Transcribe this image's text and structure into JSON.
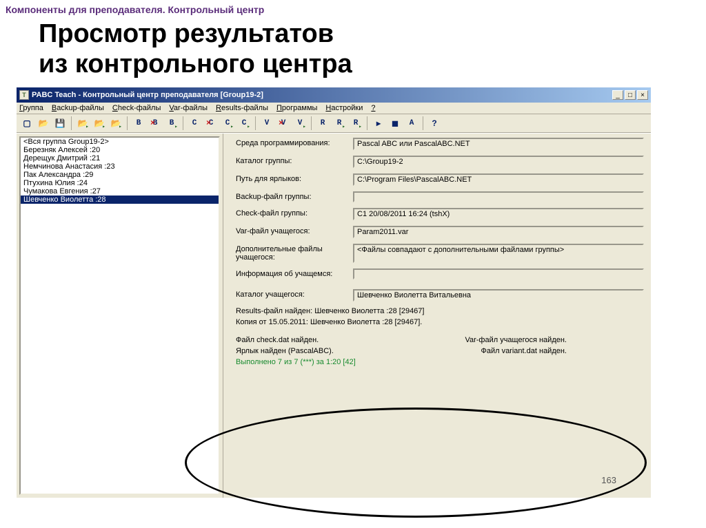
{
  "slide": {
    "header": "Компоненты для преподавателя. Контрольный центр",
    "title_line1": "Просмотр результатов",
    "title_line2": "из контрольного центра",
    "page_number": "163"
  },
  "window": {
    "title": "PABC Teach - Контрольный центр преподавателя [Group19-2]",
    "sysicon_letter": "T"
  },
  "menus": [
    "Группа",
    "Backup-файлы",
    "Check-файлы",
    "Var-файлы",
    "Results-файлы",
    "Программы",
    "Настройки",
    "?"
  ],
  "students": [
    "<Вся группа Group19-2>",
    "Березняк Алексей :20",
    "Дерещук Дмитрий :21",
    "Немчинова Анастасия :23",
    "Пак Александра :29",
    "Птухина Юлия :24",
    "Чумакова Евгения :27",
    "Шевченко Виолетта :28"
  ],
  "selected_student_index": 7,
  "fields": {
    "env_label": "Среда программирования:",
    "env_value": "Pascal ABC или PascalABC.NET",
    "groupdir_label": "Каталог группы:",
    "groupdir_value": "C:\\Group19-2",
    "shortcut_label": "Путь для ярлыков:",
    "shortcut_value": "C:\\Program Files\\PascalABC.NET",
    "backup_label": "Backup-файл группы:",
    "backup_value": "",
    "check_label": "Check-файл группы:",
    "check_value": "C1 20/08/2011 16:24 (tshX)",
    "var_label": "Var-файл учащегося:",
    "var_value": "Param2011.var",
    "addfiles_label": "Дополнительные файлы учащегося:",
    "addfiles_value": "<Файлы совпадают с дополнительными файлами группы>",
    "info_label": "Информация об учащемся:",
    "info_value": "",
    "studentdir_label": "Каталог учащегося:",
    "studentdir_value": "Шевченко Виолетта Витальевна"
  },
  "status": {
    "line1": "Results-файл найден: Шевченко Виолетта :28 [29467]",
    "line2": "Копия от 15.05.2011: Шевченко Виолетта :28 [29467].",
    "row3_left": "Файл check.dat найден.",
    "row3_right": "Var-файл учащегося найден.",
    "row4_left": "Ярлык найден (PascalABC).",
    "row4_right": "Файл variant.dat найден.",
    "green": "Выполнено 7 из 7 (***) за 1:20 [42]"
  },
  "toolbar_buttons": [
    {
      "name": "new",
      "glyph": "▢"
    },
    {
      "name": "open",
      "glyph": "📂"
    },
    {
      "name": "save",
      "glyph": "💾"
    },
    {
      "sep": true
    },
    {
      "name": "folder-b",
      "glyph": "📂",
      "arrow": true
    },
    {
      "name": "folder-c",
      "glyph": "📂",
      "arrow": true
    },
    {
      "name": "folder-r",
      "glyph": "📂",
      "arrow": true
    },
    {
      "sep": true
    },
    {
      "name": "B-btn",
      "letter": "B"
    },
    {
      "name": "Bx-btn",
      "letter": "B",
      "x": true
    },
    {
      "name": "Ba-btn",
      "letter": "B",
      "arrow": true
    },
    {
      "sep": true
    },
    {
      "name": "C-btn",
      "letter": "C"
    },
    {
      "name": "Cx-btn",
      "letter": "C",
      "x": true
    },
    {
      "name": "Ca-btn",
      "letter": "C",
      "arrow": true
    },
    {
      "name": "Ca2-btn",
      "letter": "C",
      "arrow": true
    },
    {
      "sep": true
    },
    {
      "name": "V-btn",
      "letter": "V"
    },
    {
      "name": "Vx-btn",
      "letter": "V",
      "x": true
    },
    {
      "name": "Va-btn",
      "letter": "V",
      "arrow": true
    },
    {
      "sep": true
    },
    {
      "name": "R-btn",
      "letter": "R"
    },
    {
      "name": "Ra-btn",
      "letter": "R",
      "arrow": true
    },
    {
      "name": "Ra2-btn",
      "letter": "R",
      "arrow": true
    },
    {
      "sep": true
    },
    {
      "name": "run-btn",
      "glyph": "▸"
    },
    {
      "name": "stop-btn",
      "glyph": "◼"
    },
    {
      "name": "A-btn",
      "letter": "A"
    },
    {
      "sep": true
    },
    {
      "name": "help-btn",
      "glyph": "?",
      "color": "blue"
    }
  ]
}
